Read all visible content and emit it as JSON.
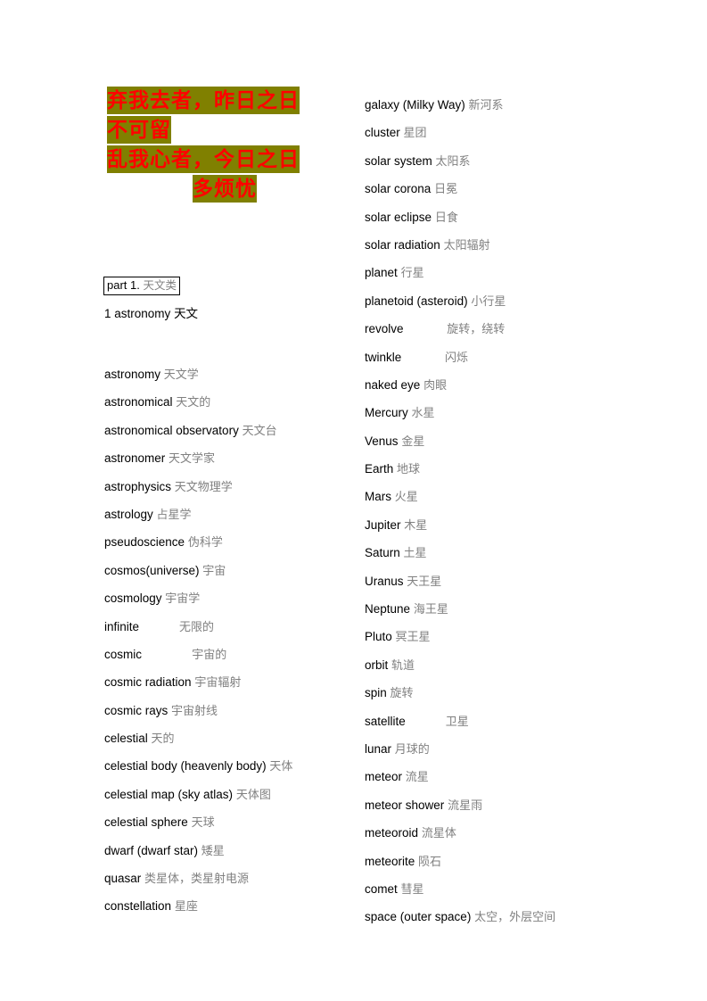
{
  "document": {
    "title_block": {
      "name": "poem-header",
      "highlight_color": "#808000",
      "text_color": "#ff0000",
      "lines": [
        {
          "text": "弃我去者，昨日之日",
          "align": "left"
        },
        {
          "text": "不可留",
          "align": "left"
        },
        {
          "text": "乱我心者，今日之日",
          "align": "left"
        },
        {
          "text": "多烦忧",
          "align": "center"
        }
      ]
    },
    "part_heading": {
      "en": "part 1.",
      "cn": "天文类"
    },
    "numbered_entry": {
      "en": "1 astronomy",
      "cn": "天文"
    },
    "columns": {
      "left": [
        {
          "en": "astronomy",
          "gap": " ",
          "cn": "天文学"
        },
        {
          "en": "astronomical",
          "gap": " ",
          "cn": "天文的"
        },
        {
          "en": "astronomical observatory",
          "gap": " ",
          "cn": "天文台"
        },
        {
          "en": "astronomer",
          "gap": " ",
          "cn": "天文学家"
        },
        {
          "en": "astrophysics",
          "gap": " ",
          "cn": "天文物理学"
        },
        {
          "en": "astrology",
          "gap": " ",
          "cn": "占星学"
        },
        {
          "en": "pseudoscience",
          "gap": " ",
          "cn": "伪科学"
        },
        {
          "en": "cosmos(universe)",
          "gap": " ",
          "cn": "宇宙"
        },
        {
          "en": "cosmology",
          "gap": " ",
          "cn": "宇宙学"
        },
        {
          "en": "infinite",
          "gap": "            ",
          "cn": "无限的"
        },
        {
          "en": "cosmic",
          "gap": "               ",
          "cn": "宇宙的"
        },
        {
          "en": "cosmic radiation",
          "gap": " ",
          "cn": "宇宙辐射"
        },
        {
          "en": "cosmic rays",
          "gap": " ",
          "cn": "宇宙射线"
        },
        {
          "en": "celestial",
          "gap": " ",
          "cn": "天的"
        },
        {
          "en": "celestial body (heavenly body)",
          "gap": " ",
          "cn": "天体"
        },
        {
          "en": "celestial map (sky atlas)",
          "gap": " ",
          "cn": "天体图"
        },
        {
          "en": "celestial sphere",
          "gap": " ",
          "cn": "天球"
        },
        {
          "en": "dwarf (dwarf star)",
          "gap": " ",
          "cn": "矮星"
        },
        {
          "en": "quasar",
          "gap": " ",
          "cn": "类星体，类星射电源"
        },
        {
          "en": "constellation",
          "gap": " ",
          "cn": "星座"
        }
      ],
      "right": [
        {
          "en": "galaxy (Milky Way)",
          "gap": " ",
          "cn": "新河系"
        },
        {
          "en": "cluster",
          "gap": " ",
          "cn": "星团"
        },
        {
          "en": "solar system",
          "gap": " ",
          "cn": "太阳系"
        },
        {
          "en": "solar corona",
          "gap": " ",
          "cn": "日冕"
        },
        {
          "en": "solar eclipse",
          "gap": " ",
          "cn": "日食"
        },
        {
          "en": "solar radiation",
          "gap": " ",
          "cn": "太阳辐射"
        },
        {
          "en": "planet",
          "gap": " ",
          "cn": "行星"
        },
        {
          "en": "planetoid (asteroid)",
          "gap": " ",
          "cn": "小行星"
        },
        {
          "en": "revolve",
          "gap": "             ",
          "cn": "旋转，绕转"
        },
        {
          "en": "twinkle",
          "gap": "             ",
          "cn": "闪烁"
        },
        {
          "en": "naked eye",
          "gap": " ",
          "cn": "肉眼"
        },
        {
          "en": "Mercury",
          "gap": " ",
          "cn": "水星"
        },
        {
          "en": "Venus",
          "gap": " ",
          "cn": "金星"
        },
        {
          "en": "Earth",
          "gap": " ",
          "cn": "地球"
        },
        {
          "en": "Mars",
          "gap": " ",
          "cn": "火星"
        },
        {
          "en": "Jupiter",
          "gap": " ",
          "cn": "木星"
        },
        {
          "en": "Saturn",
          "gap": " ",
          "cn": "土星"
        },
        {
          "en": "Uranus",
          "gap": " ",
          "cn": "天王星"
        },
        {
          "en": "Neptune",
          "gap": " ",
          "cn": "海王星"
        },
        {
          "en": "Pluto",
          "gap": " ",
          "cn": "冥王星"
        },
        {
          "en": "orbit",
          "gap": " ",
          "cn": "轨道"
        },
        {
          "en": "spin",
          "gap": " ",
          "cn": "旋转"
        },
        {
          "en": "satellite",
          "gap": "            ",
          "cn": "卫星"
        },
        {
          "en": "lunar",
          "gap": " ",
          "cn": "月球的"
        },
        {
          "en": "meteor",
          "gap": " ",
          "cn": "流星"
        },
        {
          "en": "meteor shower",
          "gap": " ",
          "cn": "流星雨"
        },
        {
          "en": "meteoroid",
          "gap": " ",
          "cn": "流星体"
        },
        {
          "en": "meteorite",
          "gap": " ",
          "cn": "陨石"
        },
        {
          "en": "comet",
          "gap": " ",
          "cn": "彗星"
        },
        {
          "en": "space (outer space)",
          "gap": " ",
          "cn": "太空，外层空间"
        }
      ]
    }
  }
}
